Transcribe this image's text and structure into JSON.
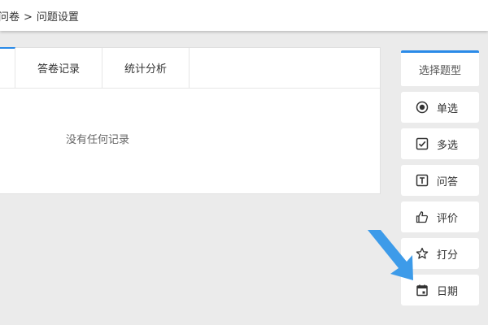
{
  "breadcrumb": {
    "parent": "问卷",
    "separator": ">",
    "current": "问题设置"
  },
  "tabs": [
    {
      "label": "答卷记录"
    },
    {
      "label": "统计分析"
    }
  ],
  "main": {
    "empty_text": "没有任何记录"
  },
  "question_types": {
    "header": "选择题型",
    "items": [
      {
        "label": "单选",
        "icon": "radio-icon"
      },
      {
        "label": "多选",
        "icon": "checkbox-icon"
      },
      {
        "label": "问答",
        "icon": "text-icon"
      },
      {
        "label": "评价",
        "icon": "thumbs-up-icon"
      },
      {
        "label": "打分",
        "icon": "star-icon"
      },
      {
        "label": "日期",
        "icon": "calendar-icon"
      }
    ]
  },
  "colors": {
    "accent": "#2a8ae8",
    "arrow": "#3d9be9",
    "background": "#ebebeb"
  }
}
